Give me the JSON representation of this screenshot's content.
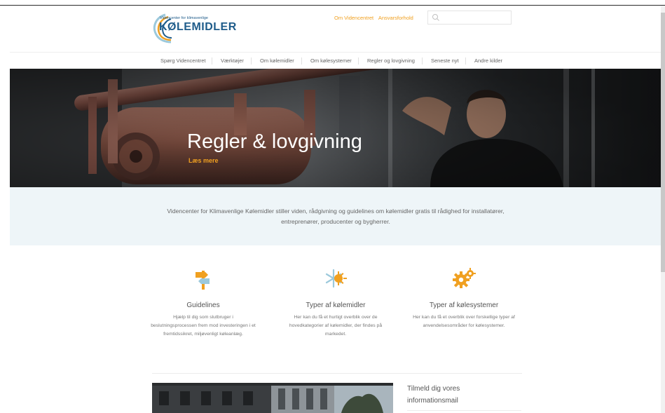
{
  "header": {
    "logo_subtitle": "Videncenter for klimavenlige",
    "logo_title": "KØLEMIDLER",
    "top_links": [
      "Om Videncentret",
      "Ansvarsforhold"
    ],
    "search": {
      "placeholder": "",
      "icon": "search-icon"
    }
  },
  "nav": {
    "items": [
      "Spørg Videncentret",
      "Værktøjer",
      "Om kølemidler",
      "Om kølesystemer",
      "Regler og lovgivning",
      "Seneste nyt",
      "Andre kilder"
    ]
  },
  "hero": {
    "title": "Regler & lovgivning",
    "link": "Læs mere"
  },
  "intro": {
    "text": "Videncenter for Klimavenlige Kølemidler stiller viden, rådgivning og guidelines om kølemidler gratis til rådighed for installatører, entreprenører, producenter og bygherrer."
  },
  "features": [
    {
      "icon": "signpost-icon",
      "title": "Guidelines",
      "description": "Hjælp til dig som slutbruger i beslutningsprocessen frem mod investeringen i et fremtidssikret, miljøvenligt køleanlæg."
    },
    {
      "icon": "snowflake-sun-icon",
      "title": "Typer af kølemidler",
      "description": "Her kan du få et hurtigt overblik over de hovedkategorier af kølemidler, der findes på markedet."
    },
    {
      "icon": "gears-icon",
      "title": "Typer af kølesystemer",
      "description": "Her kan du få et overblik over forskellige typer af anvendelsesområder for kølesystemer."
    }
  ],
  "sidebar": {
    "mail_title": "Tilmeld dig vores informationsmail"
  },
  "colors": {
    "accent": "#f0a020",
    "brand_blue": "#1f5c8a",
    "intro_bg": "#eef5f8",
    "icon_blue": "#9cc9dc"
  }
}
